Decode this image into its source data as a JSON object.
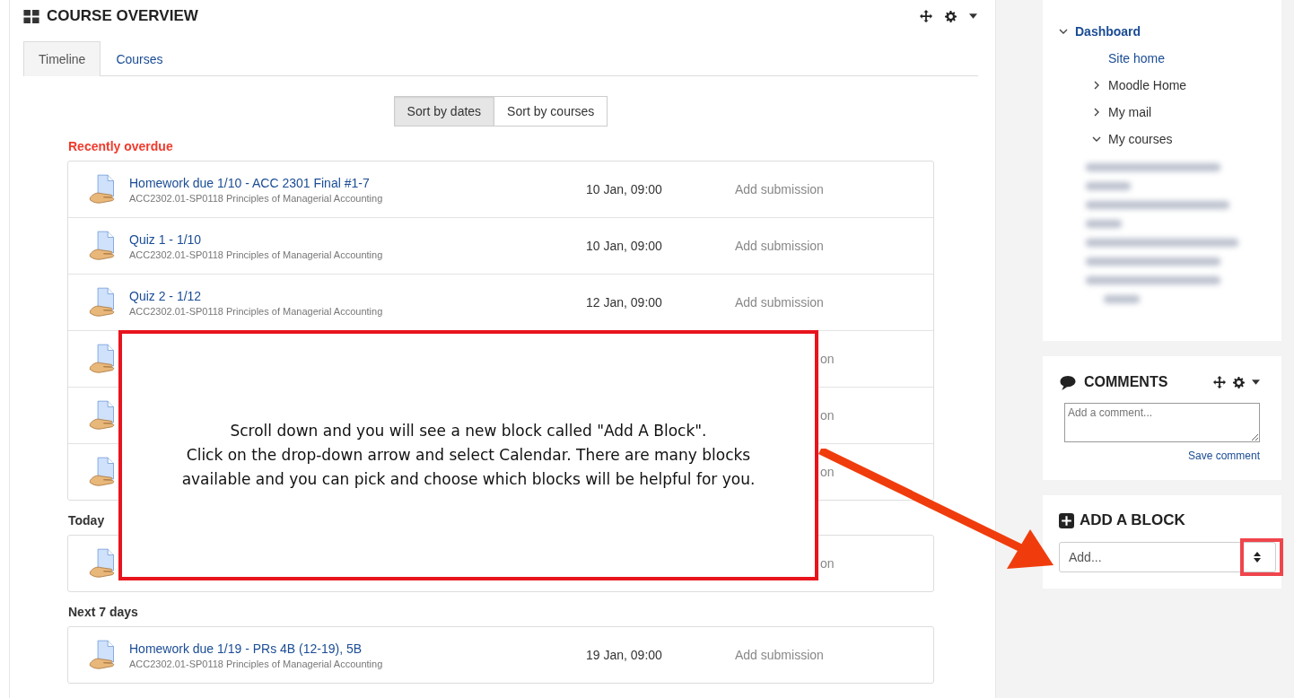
{
  "course_overview": {
    "title": "COURSE OVERVIEW",
    "tabs": [
      {
        "label": "Timeline",
        "selected": true
      },
      {
        "label": "Courses",
        "selected": false
      }
    ],
    "sort_buttons": [
      {
        "label": "Sort by dates",
        "selected": true
      },
      {
        "label": "Sort by courses",
        "selected": false
      }
    ],
    "sections": [
      {
        "heading": "Recently overdue",
        "kind": "overdue",
        "items": [
          {
            "kind": "full",
            "title": "Homework due 1/10 - ACC 2301 Final #1-7",
            "course": "ACC2302.01-SP0118 Principles of Managerial Accounting",
            "date": "10 Jan, 09:00",
            "action": "Add submission"
          },
          {
            "kind": "full",
            "title": "Quiz 1 - 1/10",
            "course": "ACC2302.01-SP0118 Principles of Managerial Accounting",
            "date": "10 Jan, 09:00",
            "action": "Add submission"
          },
          {
            "kind": "full",
            "title": "Quiz 2 - 1/12",
            "course": "ACC2302.01-SP0118 Principles of Managerial Accounting",
            "date": "12 Jan, 09:00",
            "action": "Add submission"
          },
          {
            "kind": "covered",
            "action": "on"
          },
          {
            "kind": "covered",
            "action": "on"
          },
          {
            "kind": "covered",
            "action": "on"
          }
        ]
      },
      {
        "heading": "Today",
        "kind": "normal",
        "items": [
          {
            "kind": "covered",
            "action": "on"
          }
        ]
      },
      {
        "heading": "Next 7 days",
        "kind": "normal",
        "items": [
          {
            "kind": "full",
            "title": "Homework due 1/19 - PRs 4B (12-19), 5B",
            "course": "ACC2302.01-SP0118 Principles of Managerial Accounting",
            "date": "19 Jan, 09:00",
            "action": "Add submission"
          }
        ]
      }
    ]
  },
  "navigation": {
    "items": [
      {
        "label": "Dashboard",
        "expanded": true,
        "children": [
          {
            "label": "Site home"
          },
          {
            "label": "Moodle Home",
            "expanded": false
          },
          {
            "label": "My mail",
            "expanded": false
          },
          {
            "label": "My courses",
            "expanded": true
          }
        ]
      }
    ]
  },
  "comments": {
    "title": "COMMENTS",
    "placeholder": "Add a comment...",
    "save": "Save comment"
  },
  "add_block": {
    "title": "ADD A BLOCK",
    "select": "Add..."
  },
  "callout": {
    "text": "Scroll down and you will see a new block called \"Add A Block\".\nClick on the drop-down arrow and select Calendar.  There are many blocks available and you can pick and choose which blocks will be helpful for you."
  }
}
